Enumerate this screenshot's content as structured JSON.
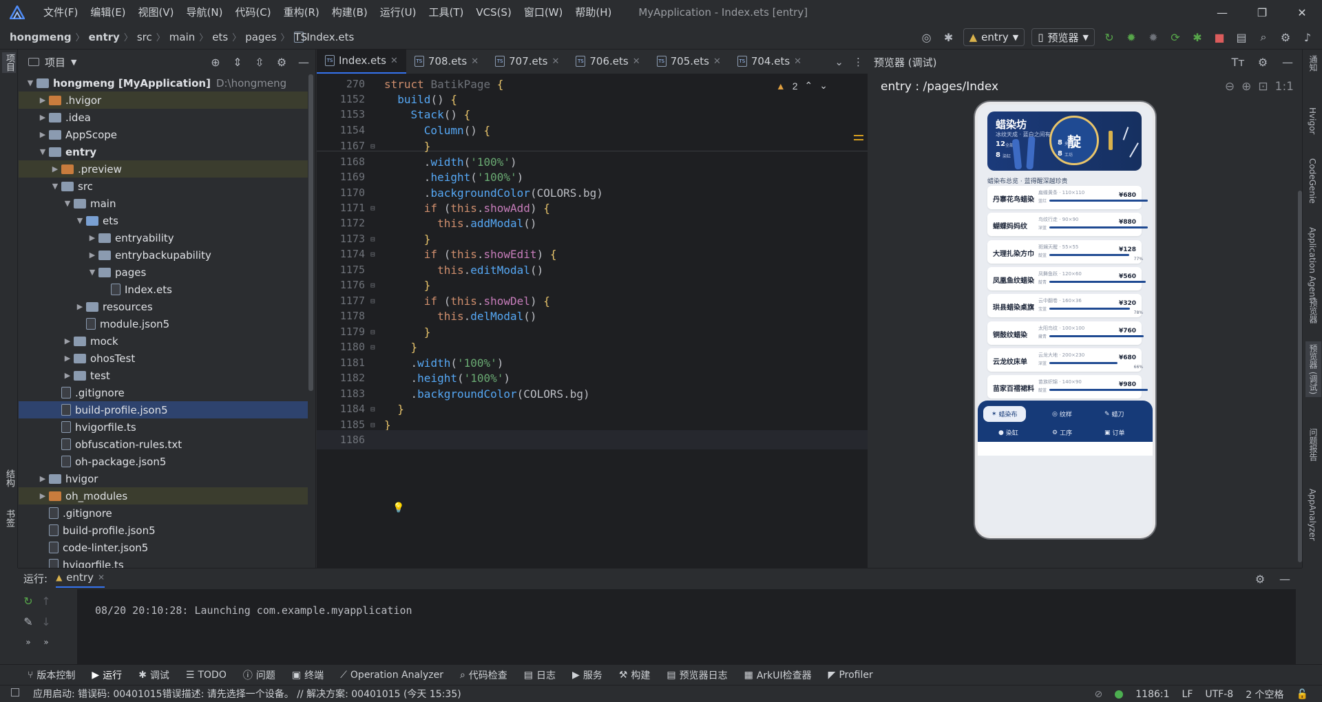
{
  "window": {
    "title": "MyApplication - Index.ets [entry]",
    "menu": [
      "文件(F)",
      "编辑(E)",
      "视图(V)",
      "导航(N)",
      "代码(C)",
      "重构(R)",
      "构建(B)",
      "运行(U)",
      "工具(T)",
      "VCS(S)",
      "窗口(W)",
      "帮助(H)"
    ],
    "controls": [
      "—",
      "❐",
      "✕"
    ]
  },
  "breadcrumb": [
    "hongmeng",
    "entry",
    "src",
    "main",
    "ets",
    "pages",
    "Index.ets"
  ],
  "toolbar": {
    "run_config": "entry",
    "device": "预览器"
  },
  "left_strip": {
    "project_label": "项目",
    "structure_label": "结构",
    "bookmarks_label": "书签"
  },
  "project_panel": {
    "title": "项目",
    "items": [
      {
        "label": "hongmeng [MyApplication]",
        "extra": "D:\\hongmeng",
        "depth": 0,
        "arrow": "down",
        "kind": "gray"
      },
      {
        "label": ".hvigor",
        "depth": 1,
        "arrow": "right",
        "kind": "orange"
      },
      {
        "label": ".idea",
        "depth": 1,
        "arrow": "right",
        "kind": "gray"
      },
      {
        "label": "AppScope",
        "depth": 1,
        "arrow": "right",
        "kind": "gray"
      },
      {
        "label": "entry",
        "depth": 1,
        "arrow": "down",
        "kind": "gray"
      },
      {
        "label": ".preview",
        "depth": 2,
        "arrow": "right",
        "kind": "orange"
      },
      {
        "label": "src",
        "depth": 2,
        "arrow": "down",
        "kind": "gray"
      },
      {
        "label": "main",
        "depth": 3,
        "arrow": "down",
        "kind": "gray"
      },
      {
        "label": "ets",
        "depth": 4,
        "arrow": "down",
        "kind": "blue"
      },
      {
        "label": "entryability",
        "depth": 5,
        "arrow": "right",
        "kind": "gray"
      },
      {
        "label": "entrybackupability",
        "depth": 5,
        "arrow": "right",
        "kind": "gray"
      },
      {
        "label": "pages",
        "depth": 5,
        "arrow": "down",
        "kind": "gray"
      },
      {
        "label": "Index.ets",
        "depth": 6,
        "arrow": "",
        "kind": "file"
      },
      {
        "label": "resources",
        "depth": 4,
        "arrow": "right",
        "kind": "gray"
      },
      {
        "label": "module.json5",
        "depth": 4,
        "arrow": "",
        "kind": "file"
      },
      {
        "label": "mock",
        "depth": 3,
        "arrow": "right",
        "kind": "gray"
      },
      {
        "label": "ohosTest",
        "depth": 3,
        "arrow": "right",
        "kind": "gray"
      },
      {
        "label": "test",
        "depth": 3,
        "arrow": "right",
        "kind": "gray"
      },
      {
        "label": ".gitignore",
        "depth": 2,
        "arrow": "",
        "kind": "file"
      },
      {
        "label": "build-profile.json5",
        "depth": 2,
        "arrow": "",
        "kind": "file",
        "selected": true
      },
      {
        "label": "hvigorfile.ts",
        "depth": 2,
        "arrow": "",
        "kind": "file"
      },
      {
        "label": "obfuscation-rules.txt",
        "depth": 2,
        "arrow": "",
        "kind": "file"
      },
      {
        "label": "oh-package.json5",
        "depth": 2,
        "arrow": "",
        "kind": "file"
      },
      {
        "label": "hvigor",
        "depth": 1,
        "arrow": "right",
        "kind": "gray"
      },
      {
        "label": "oh_modules",
        "depth": 1,
        "arrow": "right",
        "kind": "orange"
      },
      {
        "label": ".gitignore",
        "depth": 1,
        "arrow": "",
        "kind": "file"
      },
      {
        "label": "build-profile.json5",
        "depth": 1,
        "arrow": "",
        "kind": "file"
      },
      {
        "label": "code-linter.json5",
        "depth": 1,
        "arrow": "",
        "kind": "file"
      },
      {
        "label": "hvigorfile.ts",
        "depth": 1,
        "arrow": "",
        "kind": "file"
      }
    ]
  },
  "editor": {
    "tabs": [
      "Index.ets",
      "708.ets",
      "707.ets",
      "706.ets",
      "705.ets",
      "704.ets"
    ],
    "warning_count": "2",
    "lines": [
      {
        "n": "270",
        "html": "<span class='kw'>struct</span> <span class='ty'>BatikPage</span> <span class='br'>{</span>"
      },
      {
        "n": "1152",
        "html": "  <span class='fn'>build</span>() <span class='br'>{</span>"
      },
      {
        "n": "1153",
        "html": "    <span class='fn'>Stack</span>() <span class='br'>{</span>"
      },
      {
        "n": "1154",
        "html": "      <span class='fn'>Column</span>() <span class='br'>{</span>"
      },
      {
        "n": "1167",
        "html": "      <span class='br'>}</span>"
      },
      {
        "n": "1168",
        "html": "      .<span class='fn'>width</span>(<span class='st'>'100%'</span>)"
      },
      {
        "n": "1169",
        "html": "      .<span class='fn'>height</span>(<span class='st'>'100%'</span>)"
      },
      {
        "n": "1170",
        "html": "      .<span class='fn'>backgroundColor</span>(COLORS.bg)"
      },
      {
        "n": "1171",
        "html": "      <span class='kw'>if</span> (<span class='kw'>this</span>.<span class='pr'>showAdd</span>) <span class='br'>{</span>"
      },
      {
        "n": "1172",
        "html": "        <span class='kw'>this</span>.<span class='fn'>addModal</span>()"
      },
      {
        "n": "1173",
        "html": "      <span class='br'>}</span>"
      },
      {
        "n": "1174",
        "html": "      <span class='kw'>if</span> (<span class='kw'>this</span>.<span class='pr'>showEdit</span>) <span class='br'>{</span>"
      },
      {
        "n": "1175",
        "html": "        <span class='kw'>this</span>.<span class='fn'>editModal</span>()"
      },
      {
        "n": "1176",
        "html": "      <span class='br'>}</span>"
      },
      {
        "n": "1177",
        "html": "      <span class='kw'>if</span> (<span class='kw'>this</span>.<span class='pr'>showDel</span>) <span class='br'>{</span>"
      },
      {
        "n": "1178",
        "html": "        <span class='kw'>this</span>.<span class='fn'>delModal</span>()"
      },
      {
        "n": "1179",
        "html": "      <span class='br'>}</span>"
      },
      {
        "n": "1180",
        "html": "    <span class='br'>}</span>"
      },
      {
        "n": "1181",
        "html": "    .<span class='fn'>width</span>(<span class='st'>'100%'</span>)"
      },
      {
        "n": "1182",
        "html": "    .<span class='fn'>height</span>(<span class='st'>'100%'</span>)"
      },
      {
        "n": "1183",
        "html": "    .<span class='fn'>backgroundColor</span>(COLORS.bg)"
      },
      {
        "n": "1184",
        "html": "  <span class='br'>}</span>"
      },
      {
        "n": "1185",
        "html": "<span class='br'>}</span>"
      },
      {
        "n": "1186",
        "html": ""
      }
    ]
  },
  "preview": {
    "title": "预览器 (调试)",
    "route": "entry : /pages/Index",
    "app": {
      "hero_title": "蜡染坊",
      "hero_sub": "冰纹天成 · 蓝白之间有大美",
      "stats": [
        "12",
        "8",
        "8",
        "8"
      ],
      "stat_units": [
        "全部",
        "染缸",
        "夹缬",
        "工坊"
      ],
      "badge": "靛",
      "section": "蜡染布总览 · 蓝得醒深越珍贵",
      "cards": [
        {
          "name": "丹寨花鸟蜡染",
          "sub": "扁蝶黄条 · 110×110",
          "tag": "蓝红",
          "price": "¥680",
          "pct": 0.95
        },
        {
          "name": "蝴蝶妈妈纹",
          "sub": "鸟纹行走 · 90×90",
          "tag": "深蓝",
          "price": "¥880",
          "pct": 0.95
        },
        {
          "name": "大理扎染方巾",
          "sub": "斑斓天醒 · 55×55",
          "tag": "靛蓝",
          "price": "¥128",
          "pct": 0.77
        },
        {
          "name": "凤凰鱼纹蜡染",
          "sub": "凤舞鱼跃 · 120×60",
          "tag": "靛青",
          "price": "¥560",
          "pct": 0.93
        },
        {
          "name": "珙县蜡染桌旗",
          "sub": "云中翻卷 · 160×36",
          "tag": "宝蓝",
          "price": "¥320",
          "pct": 0.78
        },
        {
          "name": "铜鼓纹蜡染",
          "sub": "太阳鸟纹 · 100×100",
          "tag": "藏青",
          "price": "¥760",
          "pct": 0.91
        },
        {
          "name": "云龙纹床单",
          "sub": "云龙大地 · 200×230",
          "tag": "深蓝",
          "price": "¥680",
          "pct": 0.66
        },
        {
          "name": "苗家百褶裙料",
          "sub": "苗族织锦 · 140×90",
          "tag": "靛蓝",
          "price": "¥980",
          "pct": 0.95
        }
      ],
      "pct_labels": [
        "77%",
        "78%",
        "66%"
      ],
      "tabs": [
        [
          "蜡染布",
          "纹样",
          "蜡刀"
        ],
        [
          "染缸",
          "工序",
          "订单"
        ]
      ]
    }
  },
  "right_strip": [
    "通知",
    "Hvigor",
    "CodeGenie",
    "Application Agent",
    "预览器",
    "预览器 (调试)",
    "问题报告",
    "AppAnalyzer"
  ],
  "run_panel": {
    "label": "运行:",
    "tab": "entry",
    "message": "08/20 20:10:28: Launching com.example.myapplication"
  },
  "bottom_tools": [
    "版本控制",
    "运行",
    "调试",
    "TODO",
    "问题",
    "终端",
    "Operation Analyzer",
    "代码检查",
    "日志",
    "服务",
    "构建",
    "预览器日志",
    "ArkUI检查器",
    "Profiler"
  ],
  "status": {
    "message": "应用启动: 错误码: 00401015错误描述: 请先选择一个设备。 // 解决方案: 00401015 (今天 15:35)",
    "position": "1186:1",
    "line_sep": "LF",
    "encoding": "UTF-8",
    "indent": "2 个空格"
  },
  "colors": {
    "accent": "#3574f0",
    "selection": "#2e436e",
    "phone_brand": "#163a78"
  }
}
